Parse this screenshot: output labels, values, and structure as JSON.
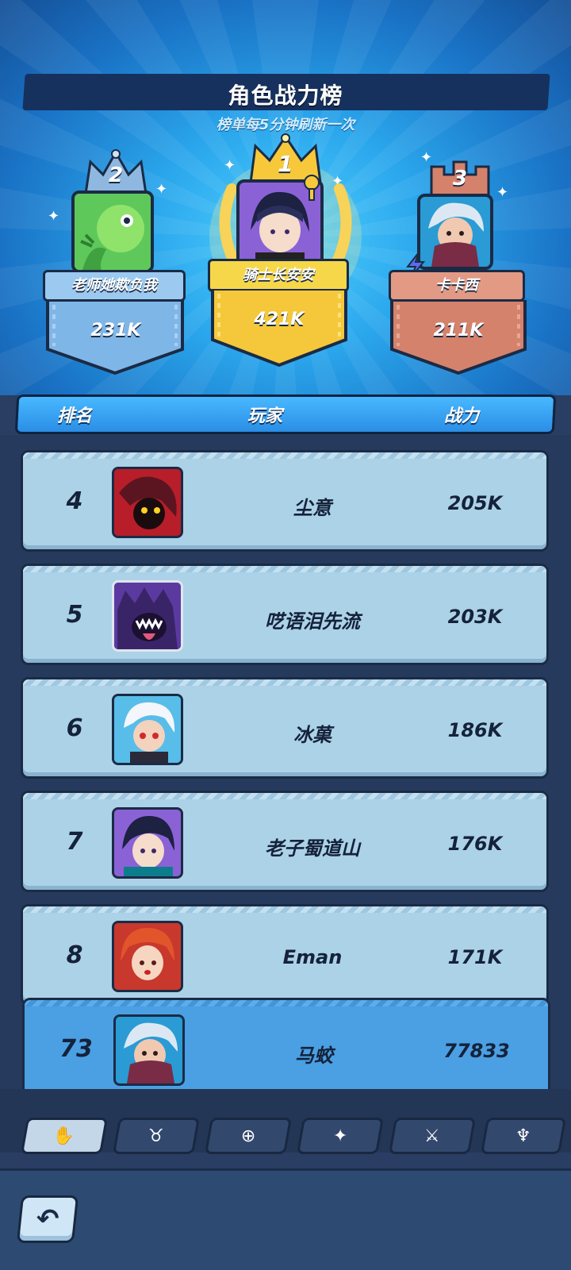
{
  "header": {
    "title": "角色战力榜",
    "subtitle": "榜单每5分钟刷新一次"
  },
  "podium": [
    {
      "rank": "1",
      "name": "骑士长安安",
      "power": "421K",
      "color": "#f7c93a"
    },
    {
      "rank": "2",
      "name": "老师她欺负我",
      "power": "231K",
      "color": "#7fb6e8"
    },
    {
      "rank": "3",
      "name": "卡卡西",
      "power": "211K",
      "color": "#d5826c"
    }
  ],
  "table": {
    "columns": [
      "排名",
      "玩家",
      "战力"
    ],
    "rows": [
      {
        "rank": "4",
        "name": "尘意",
        "power": "205K"
      },
      {
        "rank": "5",
        "name": "呓语泪先流",
        "power": "203K"
      },
      {
        "rank": "6",
        "name": "冰菓",
        "power": "186K"
      },
      {
        "rank": "7",
        "name": "老子蜀道山",
        "power": "176K"
      },
      {
        "rank": "8",
        "name": "Eman",
        "power": "171K"
      }
    ],
    "self": {
      "rank": "73",
      "name": "马蛟",
      "power": "77833"
    }
  },
  "tabs": [
    {
      "icon": "hand-icon",
      "glyph": "✋"
    },
    {
      "icon": "bull-icon",
      "glyph": "♉"
    },
    {
      "icon": "shield-plus-icon",
      "glyph": "⊕"
    },
    {
      "icon": "constellation-icon",
      "glyph": "✦"
    },
    {
      "icon": "sword-icon",
      "glyph": "⚔"
    },
    {
      "icon": "demon-icon",
      "glyph": "♆"
    }
  ],
  "back": {
    "icon": "back-arrow-icon",
    "glyph": "↶"
  },
  "colors": {
    "header_blue": "#2a8ee6",
    "row_bg": "#acd2e8",
    "self_row_bg": "#4b9fe3",
    "gold": "#f7c93a"
  }
}
